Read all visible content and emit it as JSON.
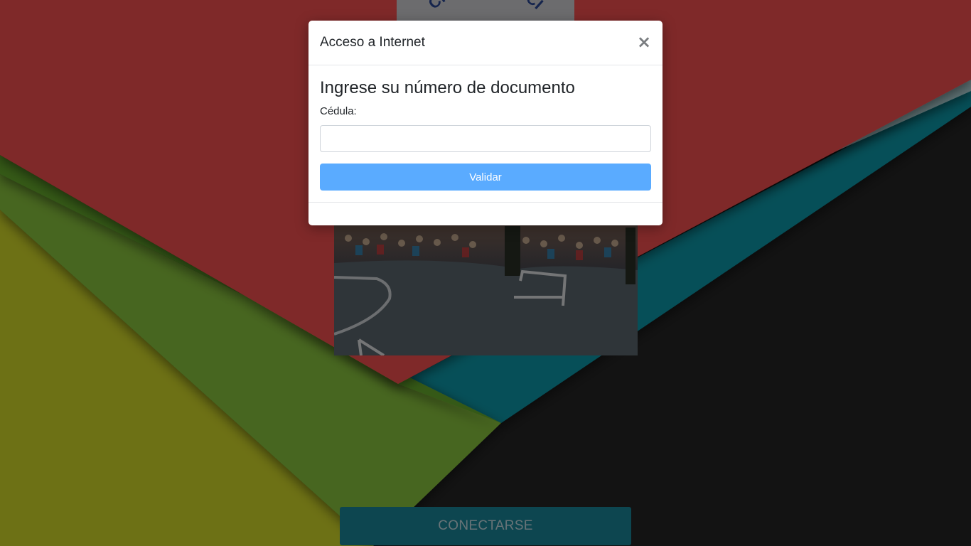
{
  "page": {
    "connect_label": "CONECTARSE",
    "logo_text": "CIÓN POBLACI"
  },
  "modal": {
    "title": "Acceso a Internet",
    "close_label": "×",
    "heading": "Ingrese su número de documento",
    "field_label": "Cédula:",
    "field_value": "",
    "field_placeholder": "",
    "submit_label": "Validar"
  },
  "colors": {
    "brand_red": "#a83232",
    "teal": "#0a7a8a",
    "button_primary": "#5aabff",
    "connect_button": "#1a8ca0"
  },
  "icons": {
    "close": "close-icon"
  }
}
